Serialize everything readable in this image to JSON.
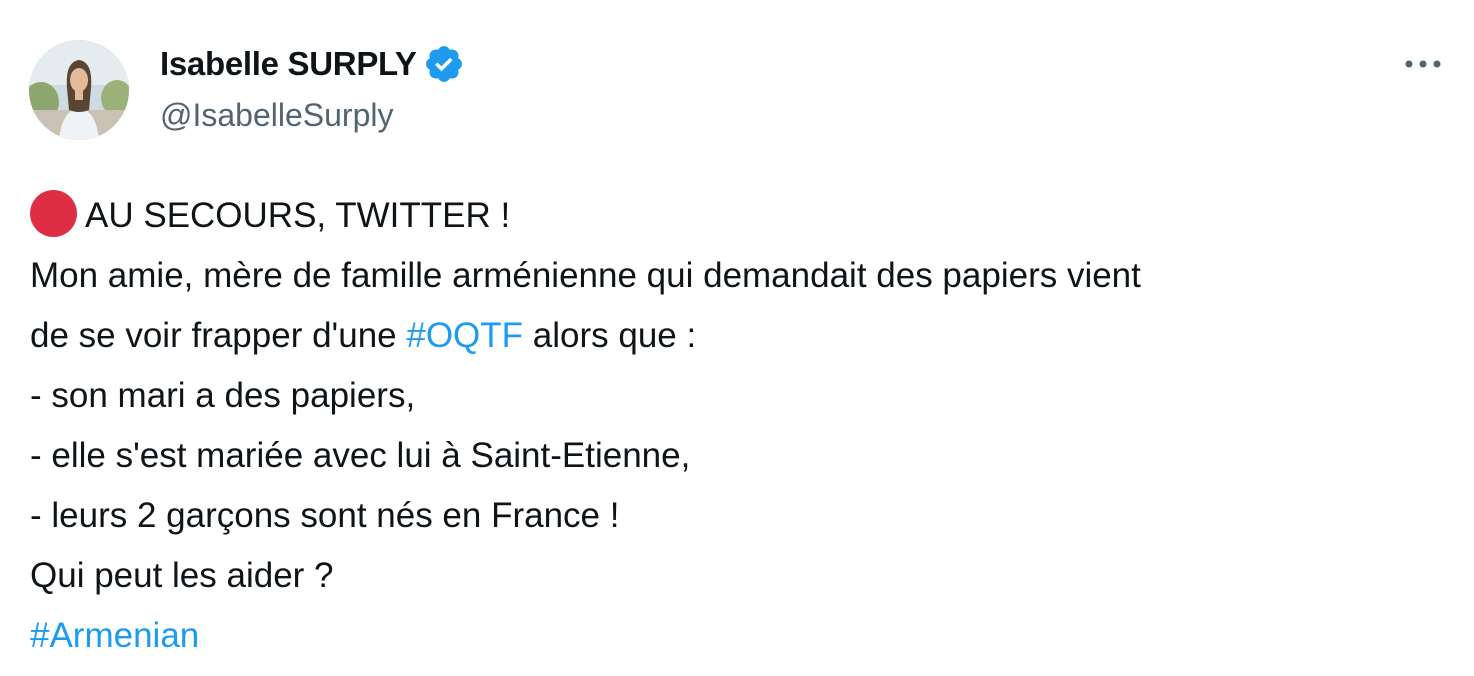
{
  "author": {
    "display_name": "Isabelle SURPLY",
    "handle": "@IsabelleSurply",
    "verified": true
  },
  "icons": {
    "verified": "verified-badge-icon",
    "more": "more-options-icon",
    "red_circle": "red-circle-emoji"
  },
  "colors": {
    "text": "#0f1419",
    "secondary_text": "#536471",
    "link": "#1d9bf0",
    "verified": "#1d9bf0",
    "red_circle": "#dd2e44"
  },
  "tweet": {
    "line1": "AU SECOURS, TWITTER !",
    "line2": "Mon amie, mère de famille arménienne qui demandait des papiers vient",
    "line3_before": "de se voir frapper d'une ",
    "line3_hashtag": "#OQTF",
    "line3_after": " alors que :",
    "line4": "- son mari a des papiers,",
    "line5": "- elle s'est mariée avec lui à Saint-Etienne,",
    "line6": "- leurs 2 garçons sont nés en France !",
    "line7": "Qui peut les aider ?",
    "line8_hashtag": "#Armenian"
  }
}
